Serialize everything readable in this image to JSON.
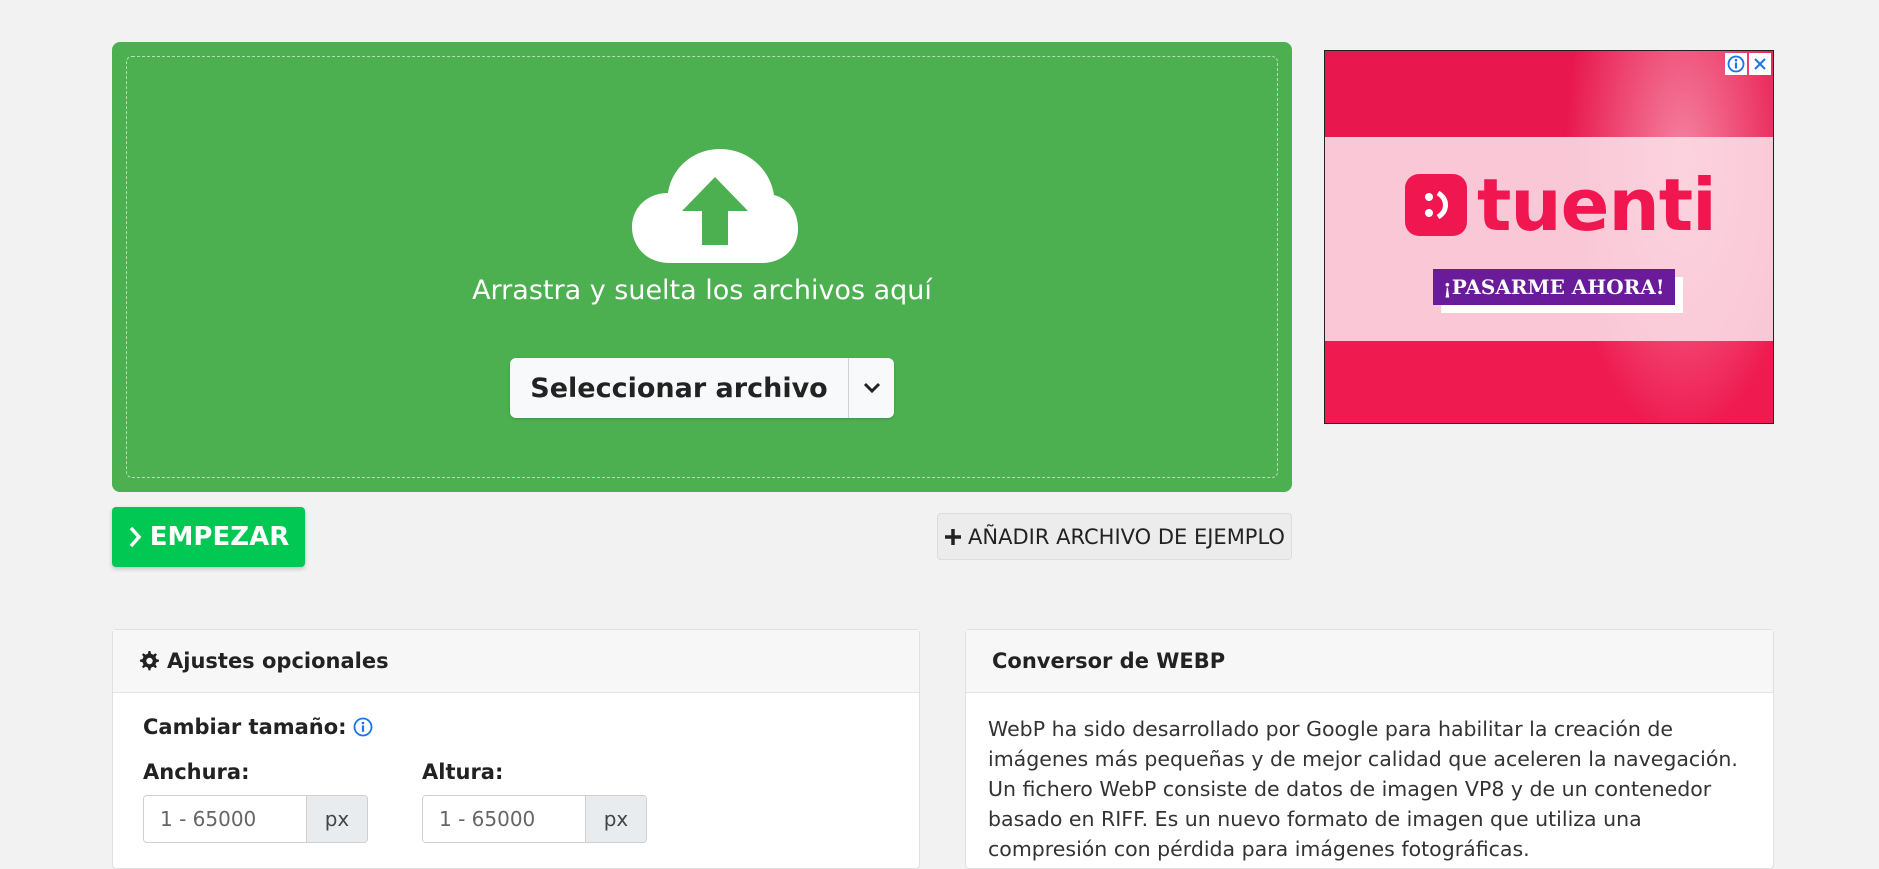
{
  "upload": {
    "drop_text": "Arrastra y suelta los archivos aquí",
    "select_label": "Seleccionar archivo",
    "cloud_icon": "cloud-upload-icon",
    "background_color": "#4caf50"
  },
  "actions": {
    "start_label": "EMPEZAR",
    "start_color": "#00c853",
    "example_label": "AÑADIR ARCHIVO DE EJEMPLO"
  },
  "ad": {
    "brand": "tuenti",
    "cta": "¡PASARME AHORA!",
    "info_icon": "info-icon",
    "close_icon": "close-icon"
  },
  "settings": {
    "title": "Ajustes opcionales",
    "resize_label": "Cambiar tamaño:",
    "width_label": "Anchura:",
    "height_label": "Altura:",
    "width_placeholder": "1 - 65000",
    "height_placeholder": "1 - 65000",
    "unit": "px"
  },
  "info": {
    "title": "Conversor de WEBP",
    "text": "WebP ha sido desarrollado por Google para habilitar la creación de imágenes más pequeñas y de mejor calidad que aceleren la navegación. Un fichero WebP consiste de datos de imagen VP8 y de un contenedor basado en RIFF. Es un nuevo formato de imagen que utiliza una compresión con pérdida para imágenes fotográficas."
  }
}
